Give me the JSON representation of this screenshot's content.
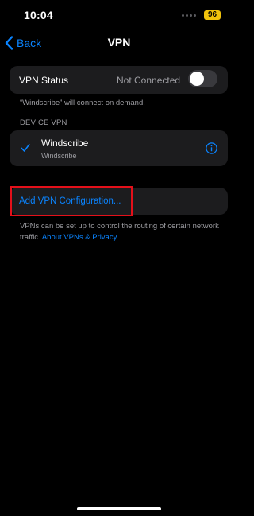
{
  "status_bar": {
    "time": "10:04",
    "battery": "96",
    "battery_color": "#f0c20c"
  },
  "nav": {
    "back_label": "Back",
    "title": "VPN",
    "back_icon": "chevron-left-icon"
  },
  "vpn_status": {
    "label": "VPN Status",
    "value": "Not Connected",
    "toggle_on": false,
    "footnote": "“Windscribe” will connect on demand."
  },
  "device_vpn": {
    "header": "DEVICE VPN",
    "item": {
      "name": "Windscribe",
      "subtitle": "Windscribe",
      "selected": true,
      "check_icon": "checkmark-icon",
      "info_icon": "info-icon"
    }
  },
  "add_config": {
    "label": "Add VPN Configuration..."
  },
  "footer": {
    "text": "VPNs can be set up to control the routing of certain network traffic.",
    "link": "About VPNs & Privacy..."
  },
  "colors": {
    "accent": "#0a84ff",
    "background": "#000000",
    "card": "#1c1c1e",
    "highlight": "#e4101a"
  }
}
